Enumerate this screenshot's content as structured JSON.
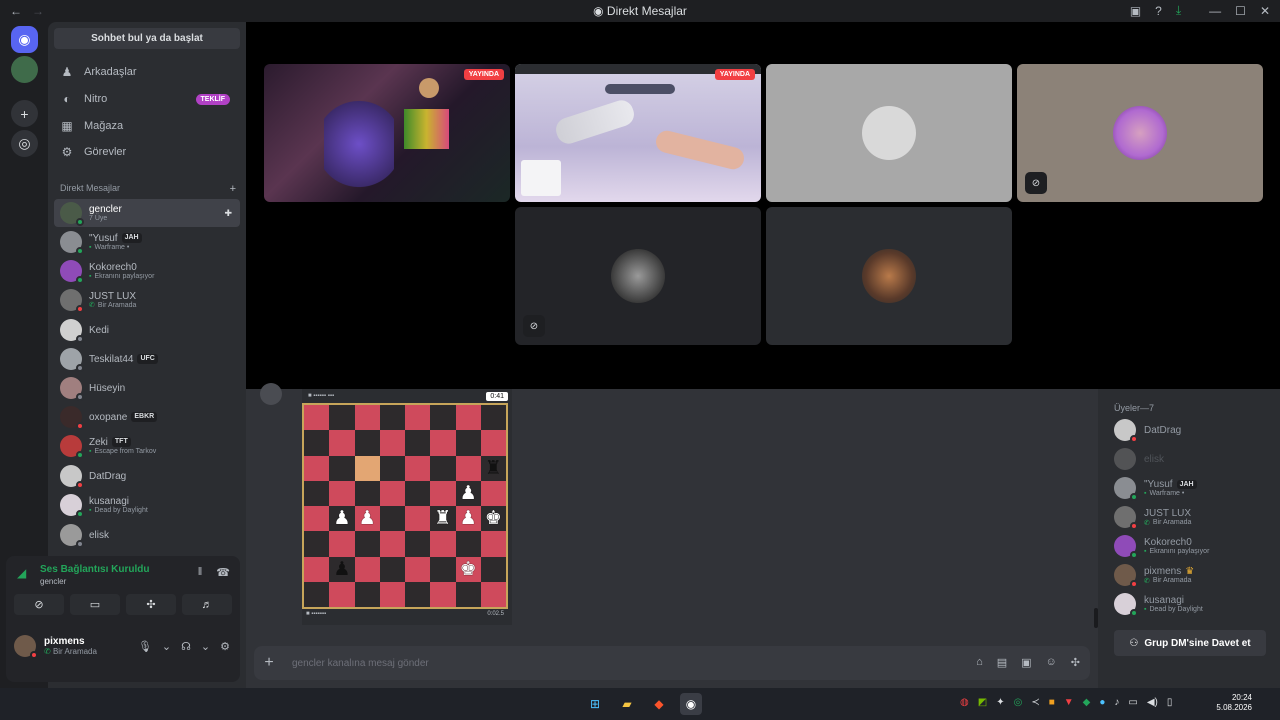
{
  "window": {
    "title": "Direkt Mesajlar"
  },
  "sidebar": {
    "search_label": "Sohbet bul ya da başlat",
    "nav": [
      {
        "label": "Arkadaşlar",
        "icon": "friends-icon"
      },
      {
        "label": "Nitro",
        "icon": "nitro-icon",
        "badge": "TEKLİF"
      },
      {
        "label": "Mağaza",
        "icon": "shop-icon"
      },
      {
        "label": "Görevler",
        "icon": "quests-icon"
      }
    ],
    "dm_header": "Direkt Mesajlar",
    "dms": [
      {
        "name": "gencler",
        "sub": "7 Üye"
      },
      {
        "name": "\"Yusuf",
        "tag": "JAH",
        "sub": "Warframe •"
      },
      {
        "name": "Kokorech0",
        "sub": "Ekranını paylaşıyor"
      },
      {
        "name": "JUST LUX",
        "sub": "Bir Aramada"
      },
      {
        "name": "Kedi",
        "sub": ""
      },
      {
        "name": "Teskilat44",
        "tag": "UFC",
        "sub": ""
      },
      {
        "name": "Hüseyin",
        "sub": ""
      },
      {
        "name": "oxopane",
        "tag": "EBKR",
        "sub": ""
      },
      {
        "name": "Zeki",
        "tag": "TFT",
        "sub": "Escape from Tarkov"
      },
      {
        "name": "DatDrag",
        "sub": ""
      },
      {
        "name": "kusanagi",
        "sub": "Dead by Daylight"
      },
      {
        "name": "elisk",
        "sub": ""
      }
    ]
  },
  "voice": {
    "status": "Ses Bağlantısı Kuruldu",
    "channel": "gencler"
  },
  "user": {
    "name": "pixmens",
    "status": "Bir Aramada"
  },
  "stage": {
    "live_label": "YAYINDA"
  },
  "chess": {
    "timer_top": "0:41",
    "timer_bottom": "0:02.5"
  },
  "composer": {
    "placeholder": "gencler kanalına mesaj gönder"
  },
  "members": {
    "header": "Üyeler—7",
    "list": [
      {
        "name": "DatDrag",
        "sub": ""
      },
      {
        "name": "elisk",
        "sub": ""
      },
      {
        "name": "\"Yusuf",
        "tag": "JAH",
        "sub": "Warframe •"
      },
      {
        "name": "JUST LUX",
        "sub": "Bir Aramada"
      },
      {
        "name": "Kokorech0",
        "sub": "Ekranını paylaşıyor"
      },
      {
        "name": "pixmens",
        "sub": "Bir Aramada"
      },
      {
        "name": "kusanagi",
        "sub": "Dead by Daylight"
      }
    ],
    "invite_label": "Grup DM'sine Davet et"
  },
  "taskbar": {
    "time": "20:24",
    "date": "5.08.2026"
  },
  "colors": {
    "accent": "#5865f2",
    "online": "#23a55a",
    "dnd": "#f23f43",
    "live": "#f23f43"
  }
}
